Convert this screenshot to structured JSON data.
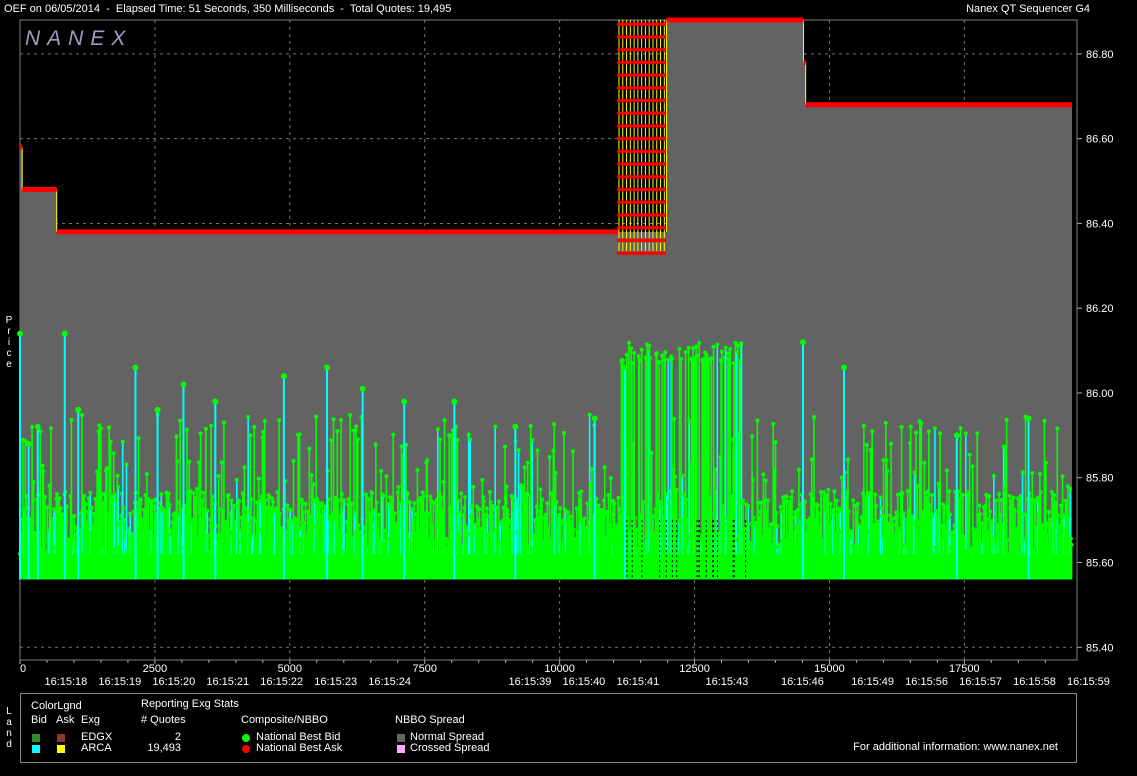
{
  "header": {
    "left_title": "OEF on 06/05/2014  -  Elapsed Time: 51 Seconds, 350 Milliseconds  -  Total Quotes: 19,495",
    "right_title": "Nanex QT Sequencer G4",
    "watermark": "NANEX"
  },
  "side_labels": {
    "price": "Price",
    "legend": "Land"
  },
  "colors": {
    "background": "#000000",
    "normal_spread": "#636363",
    "best_bid": "#00ff00",
    "best_ask": "#ff0000",
    "arca_bid": "#00ffff",
    "ask_connector": "#ffff00"
  },
  "chart_data": {
    "type": "line",
    "ylabel": "Price",
    "ylim": [
      85.37,
      86.88
    ],
    "xlim": [
      0,
      19495
    ],
    "grid": true,
    "yticks": [
      "86.80",
      "86.60",
      "86.40",
      "86.20",
      "86.00",
      "85.80",
      "85.60",
      "85.40"
    ],
    "ytick_values": [
      86.8,
      86.6,
      86.4,
      86.2,
      86.0,
      85.8,
      85.6,
      85.4
    ],
    "xticks": [
      "0",
      "2500",
      "5000",
      "7500",
      "10000",
      "12500",
      "15000",
      "17500"
    ],
    "xtick_values": [
      0,
      2500,
      5000,
      7500,
      10000,
      12500,
      15000,
      17500
    ],
    "time_labels": [
      "16:15:18",
      "16:15:19",
      "16:15:20",
      "16:15:21",
      "16:15:22",
      "16:15:23",
      "16:15:24",
      "16:15:39",
      "16:15:40",
      "16:15:41",
      "16:15:43",
      "16:15:46",
      "16:15:49",
      "16:15:56",
      "16:15:57",
      "16:15:58",
      "16:15:59"
    ],
    "time_label_positions": [
      850,
      1850,
      2850,
      3850,
      4850,
      5850,
      6850,
      9450,
      10450,
      11450,
      13100,
      14500,
      15800,
      16800,
      17800,
      18800,
      19800
    ],
    "series": [
      {
        "name": "National Best Ask",
        "steps": [
          [
            0,
            86.58
          ],
          [
            40,
            86.48
          ],
          [
            680,
            86.38
          ],
          [
            11100,
            86.38
          ],
          [
            11120,
            "osc"
          ],
          [
            11980,
            86.88
          ],
          [
            14520,
            86.78
          ],
          [
            14560,
            86.68
          ],
          [
            19495,
            86.68
          ]
        ]
      },
      {
        "name": "National Best Bid",
        "floor": 85.56,
        "typical_range": [
          85.62,
          85.95
        ],
        "spikes": [
          [
            0,
            86.14
          ],
          [
            160,
            85.88
          ],
          [
            330,
            85.92
          ],
          [
            830,
            86.14
          ],
          [
            1080,
            85.96
          ],
          [
            2140,
            86.06
          ],
          [
            2550,
            85.96
          ],
          [
            3030,
            86.02
          ],
          [
            3620,
            85.98
          ],
          [
            4890,
            86.04
          ],
          [
            5690,
            86.06
          ],
          [
            6350,
            86.01
          ],
          [
            7120,
            85.98
          ],
          [
            8050,
            85.98
          ],
          [
            9180,
            85.92
          ],
          [
            10650,
            85.94
          ],
          [
            11210,
            86.06
          ],
          [
            14510,
            86.12
          ],
          [
            15270,
            86.06
          ],
          [
            17360,
            85.9
          ],
          [
            18690,
            85.94
          ]
        ]
      }
    ],
    "burst": {
      "x_range": [
        11100,
        13450
      ],
      "bid_high": 86.12,
      "ask_low": 86.33,
      "ask_high": 86.88
    }
  },
  "legend": {
    "color_legend": {
      "title": "ColorLgnd",
      "bid": "Bid",
      "ask": "Ask",
      "exg": "Exg"
    },
    "exchanges": [
      {
        "name": "EDGX",
        "bid_color": "#2e8b2e",
        "ask_color": "#8b3a2e",
        "quotes": "2"
      },
      {
        "name": "ARCA",
        "bid_color": "#00ffff",
        "ask_color": "#ffff00",
        "quotes": "19,493"
      }
    ],
    "stats": {
      "title": "Reporting Exg Stats",
      "subtitle": "# Quotes"
    },
    "composite": {
      "title": "Composite/NBBO",
      "bid_label": "National Best Bid",
      "ask_label": "National Best Ask"
    },
    "spread": {
      "title": "NBBO Spread",
      "normal_label": "Normal Spread",
      "crossed_label": "Crossed Spread",
      "normal_color": "#636363",
      "crossed_color": "#ffaaff"
    },
    "info": "For additional information: www.nanex.net"
  }
}
